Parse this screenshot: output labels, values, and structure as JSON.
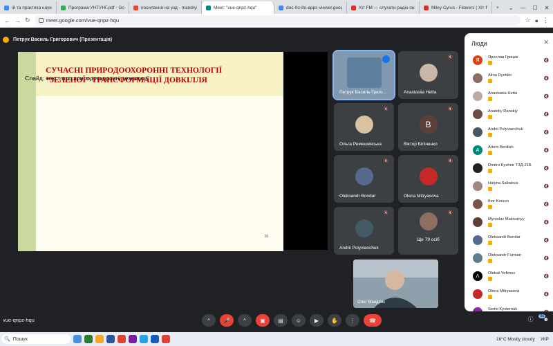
{
  "browser": {
    "tabs": [
      {
        "label": "ій та практика наукових ×",
        "color": "#4285f4",
        "active": false
      },
      {
        "label": "Програма УНТУНГ.pdf - Goog",
        "color": "#34a853",
        "active": false
      },
      {
        "label": "посилання на узд - mandryk@",
        "color": "#ea4335",
        "active": false
      },
      {
        "label": "Meet: \"vue-qnpz-hqu\"",
        "color": "#00897b",
        "active": true
      },
      {
        "label": "doc-0o-8o-apps-viewer.google",
        "color": "#4285f4",
        "active": false
      },
      {
        "label": "Хіт FM — слухати радіо онлайн",
        "color": "#d93025",
        "active": false
      },
      {
        "label": "Miley Cyrus - Flowers | Хіт FM",
        "color": "#d93025",
        "active": false
      }
    ],
    "new_tab": "+",
    "window_controls": [
      "⌄",
      "—",
      "☐",
      "✕"
    ],
    "url": "meet.google.com/vue-qnpz-hqu"
  },
  "meet": {
    "presenter_label": "Петрук Василь Григорович (Презентація)",
    "meeting_code": "vue-qnpz-hqu",
    "self_name": "Олег Мандрик"
  },
  "slide": {
    "title_line1": "Сучасні природоохоронні технології",
    "title_line2": "“зеленої” трансформації довкілля",
    "page_number": "16"
  },
  "tiles": [
    {
      "name": "Петрук Василь Григо...",
      "initial": "",
      "color": "#5f7f9f"
    },
    {
      "name": "Anastasiia Hetta",
      "initial": "",
      "color": "#c9b8a8"
    },
    {
      "name": "Ольга Ремешевська",
      "initial": "",
      "color": "#d9c2a0"
    },
    {
      "name": "Віктор Біліченко",
      "initial": "В",
      "color": "#5d4037"
    },
    {
      "name": "Oleksandr Bondar",
      "initial": "",
      "color": "#556b8d"
    },
    {
      "name": "Olena Mitryasova",
      "initial": "",
      "color": "#c62828"
    },
    {
      "name": "Andrii Polyvianchuk",
      "initial": "",
      "color": "#455a64"
    },
    {
      "name": "Ще 79 осіб",
      "initial": "",
      "color": "#8d6e63"
    }
  ],
  "people": {
    "title": "Люди",
    "list": [
      {
        "name": "Ярослав Грицик",
        "initial": "Я",
        "color": "#d84315"
      },
      {
        "name": "Alina Dychko",
        "initial": "",
        "color": "#8d6e63"
      },
      {
        "name": "Anastasiia Hetta",
        "initial": "",
        "color": "#bcaaa4"
      },
      {
        "name": "Anatoliy Ranskiy",
        "initial": "",
        "color": "#6d4c41"
      },
      {
        "name": "Andrii Polyvianchuk",
        "initial": "",
        "color": "#455a64"
      },
      {
        "name": "Artem Berdish",
        "initial": "A",
        "color": "#00897b"
      },
      {
        "name": "Dmitro Kyshnir ТЗД-21Б",
        "initial": "",
        "color": "#212121"
      },
      {
        "name": "Halyna Sakalova",
        "initial": "",
        "color": "#a1887f"
      },
      {
        "name": "Ihor Korsun",
        "initial": "",
        "color": "#795548"
      },
      {
        "name": "Myroslav Malovanyy",
        "initial": "",
        "color": "#5d4037"
      },
      {
        "name": "Oleksandr Bondar",
        "initial": "",
        "color": "#556b8d"
      },
      {
        "name": "Oleksandr Furman",
        "initial": "",
        "color": "#607d8b"
      },
      {
        "name": "Oleksii Yefimov",
        "initial": "Λ",
        "color": "#000000"
      },
      {
        "name": "Olena Mitryasova",
        "initial": "",
        "color": "#c62828"
      },
      {
        "name": "Serhii Kysternuk",
        "initial": "",
        "color": "#8e24aa"
      }
    ]
  },
  "controls": {
    "arrow_icon": "^",
    "participants_badge": "88"
  },
  "taskbar": {
    "search_label": "Пошук",
    "weather": "16°C  Mostly cloudy",
    "language": "УКР"
  }
}
